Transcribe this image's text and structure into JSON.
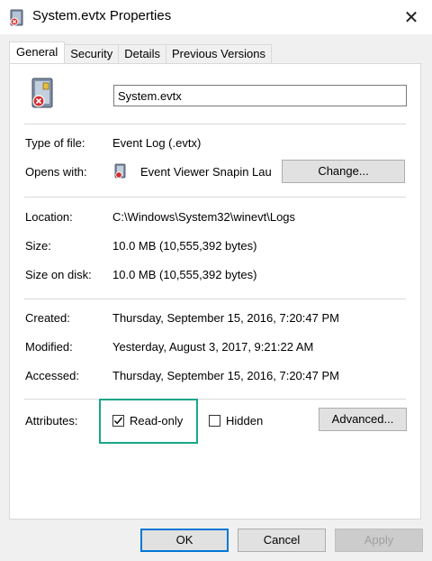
{
  "window": {
    "title": "System.evtx Properties",
    "close_glyph": "✕"
  },
  "tabs": [
    {
      "label": "General",
      "active": true
    },
    {
      "label": "Security"
    },
    {
      "label": "Details"
    },
    {
      "label": "Previous Versions"
    }
  ],
  "general": {
    "file_name": "System.evtx",
    "type_label": "Type of file:",
    "type_value": "Event Log (.evtx)",
    "opens_label": "Opens with:",
    "opens_value": "Event Viewer Snapin Lau",
    "change_button": "Change...",
    "location_label": "Location:",
    "location_value": "C:\\Windows\\System32\\winevt\\Logs",
    "size_label": "Size:",
    "size_value": "10.0 MB (10,555,392 bytes)",
    "size_disk_label": "Size on disk:",
    "size_disk_value": "10.0 MB (10,555,392 bytes)",
    "created_label": "Created:",
    "created_value": "Thursday, September 15, 2016, 7:20:47 PM",
    "modified_label": "Modified:",
    "modified_value": "Yesterday, August 3, 2017, 9:21:22 AM",
    "accessed_label": "Accessed:",
    "accessed_value": "Thursday, September 15, 2016, 7:20:47 PM",
    "attributes_label": "Attributes:",
    "readonly_label": "Read-only",
    "readonly_checked": true,
    "hidden_label": "Hidden",
    "hidden_checked": false,
    "advanced_button": "Advanced..."
  },
  "footer": {
    "ok": "OK",
    "cancel": "Cancel",
    "apply": "Apply"
  },
  "colors": {
    "accent": "#0078d7",
    "highlight": "#1aa68a"
  }
}
